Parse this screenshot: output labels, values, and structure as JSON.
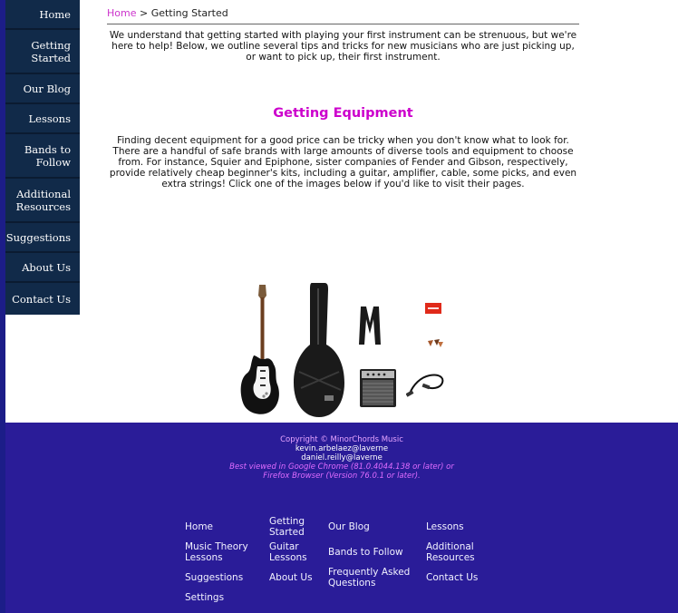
{
  "sidebar": {
    "items": [
      {
        "label": "Home"
      },
      {
        "label": "Getting Started"
      },
      {
        "label": "Our Blog"
      },
      {
        "label": "Lessons"
      },
      {
        "label": "Bands to Follow"
      },
      {
        "label": "Additional Resources"
      },
      {
        "label": "Suggestions"
      },
      {
        "label": "About Us"
      },
      {
        "label": "Contact Us"
      }
    ]
  },
  "breadcrumb": {
    "home": "Home",
    "separator": " > ",
    "current": "Getting Started"
  },
  "intro": "We understand that getting started with playing your first instrument can be strenuous, but we're here to help! Below, we outline several tips and tricks for new musicians who are just picking up, or want to pick up, their first instrument.",
  "section": {
    "heading": "Getting Equipment",
    "body": "Finding decent equipment for a good price can be tricky when you don't know what to look for. There are a handful of safe brands with large amounts of diverse tools and equipment to choose from. For instance, Squier and Epiphone, sister companies of Fender and Gibson, respectively, provide relatively cheap beginner's kits, including a guitar, amplifier, cable, some picks, and even extra strings! Click one of the images below if you'd like to visit their pages."
  },
  "footer": {
    "copyright": "Copyright © MinorChords Music",
    "emails": [
      "kevin.arbelaez@laverne",
      "daniel.reilly@laverne"
    ],
    "best_viewed_1": "Best viewed in Google Chrome (81.0.4044.138 or later) or",
    "best_viewed_2": "Firefox Browser (Version 76.0.1 or later).",
    "links": {
      "home": "Home",
      "getting_started": "Getting Started",
      "our_blog": "Our Blog",
      "lessons": "Lessons",
      "music_theory": "Music Theory Lessons",
      "guitar_lessons": "Guitar Lessons",
      "bands": "Bands to Follow",
      "additional": "Additional Resources",
      "suggestions": "Suggestions",
      "about": "About Us",
      "faq": "Frequently Asked Questions",
      "contact": "Contact Us",
      "settings": "Settings"
    }
  },
  "colors": {
    "sidebar_bg": "#112a49",
    "footer_bg": "#2a1c98",
    "accent": "#cc00cc"
  }
}
